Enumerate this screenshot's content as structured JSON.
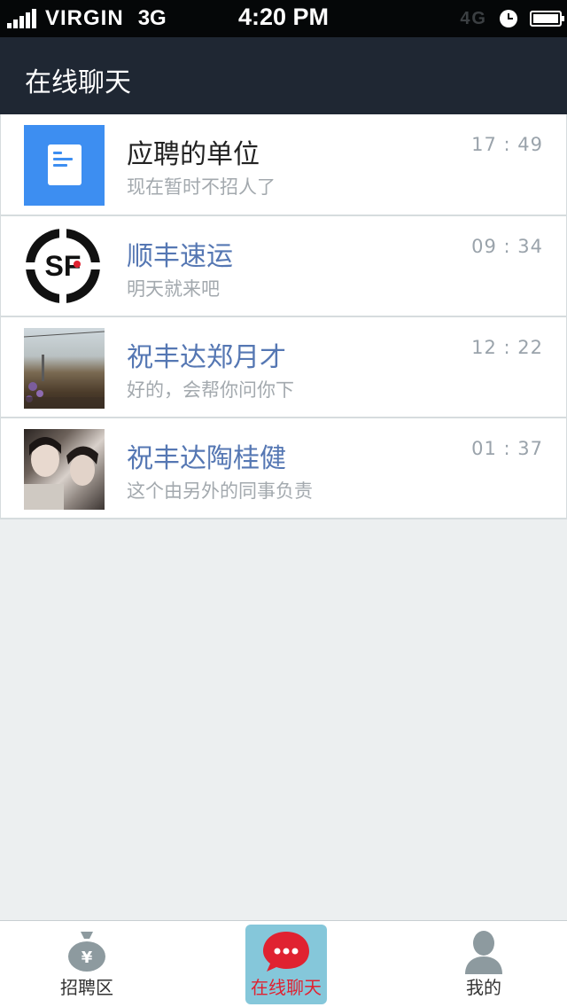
{
  "status_bar": {
    "carrier": "VIRGIN",
    "network": "3G",
    "time": "4:20 PM",
    "ghost_text": "4G",
    "icons": [
      "signal-icon",
      "alarm-clock-icon",
      "battery-icon"
    ]
  },
  "header": {
    "title": "在线聊天"
  },
  "chats": [
    {
      "name": "应聘的单位",
      "message": "现在暂时不招人了",
      "time": "17 : 49",
      "avatar": "document-icon"
    },
    {
      "name": "顺丰速运",
      "message": "明天就来吧",
      "time": "09 : 34",
      "avatar": "sf-logo"
    },
    {
      "name": "祝丰达郑月才",
      "message": "好的，会帮你问你下",
      "time": "12 : 22",
      "avatar": "photo-avatar"
    },
    {
      "name": "祝丰达陶桂健",
      "message": "这个由另外的同事负责",
      "time": "01 : 37",
      "avatar": "photo-avatar"
    }
  ],
  "tab_bar": {
    "tabs": [
      {
        "label": "招聘区",
        "icon": "money-bag-icon",
        "active": false
      },
      {
        "label": "在线聊天",
        "icon": "chat-bubble-icon",
        "active": true
      },
      {
        "label": "我的",
        "icon": "person-icon",
        "active": false
      }
    ]
  },
  "colors": {
    "header_bg": "#1f2733",
    "name_blue": "#5577b3",
    "active_tab_bg": "#85c7da",
    "active_tab_text": "#e02231",
    "page_bg": "#eceff0"
  }
}
